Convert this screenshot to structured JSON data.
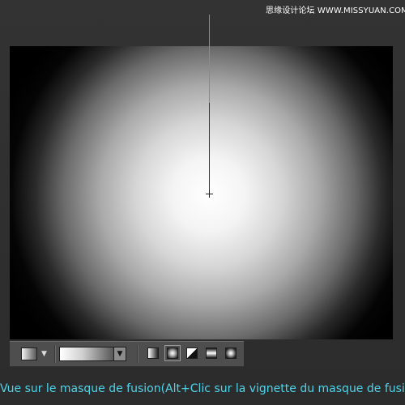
{
  "watermark": "思缘设计论坛 WWW.MISSYUAN.COM",
  "caption": "Vue sur le masque de fusion(Alt+Clic sur la vignette du masque de fusion)",
  "toolbar": {
    "preset_icon": "gradient-preset-icon",
    "picker_icon": "gradient-picker-icon",
    "gradient_types": [
      "linear-gradient-icon",
      "radial-gradient-icon",
      "angle-gradient-icon",
      "reflected-gradient-icon",
      "diamond-gradient-icon"
    ],
    "active_type": "radial-gradient-icon"
  },
  "caption_color": "#4fd4ea"
}
